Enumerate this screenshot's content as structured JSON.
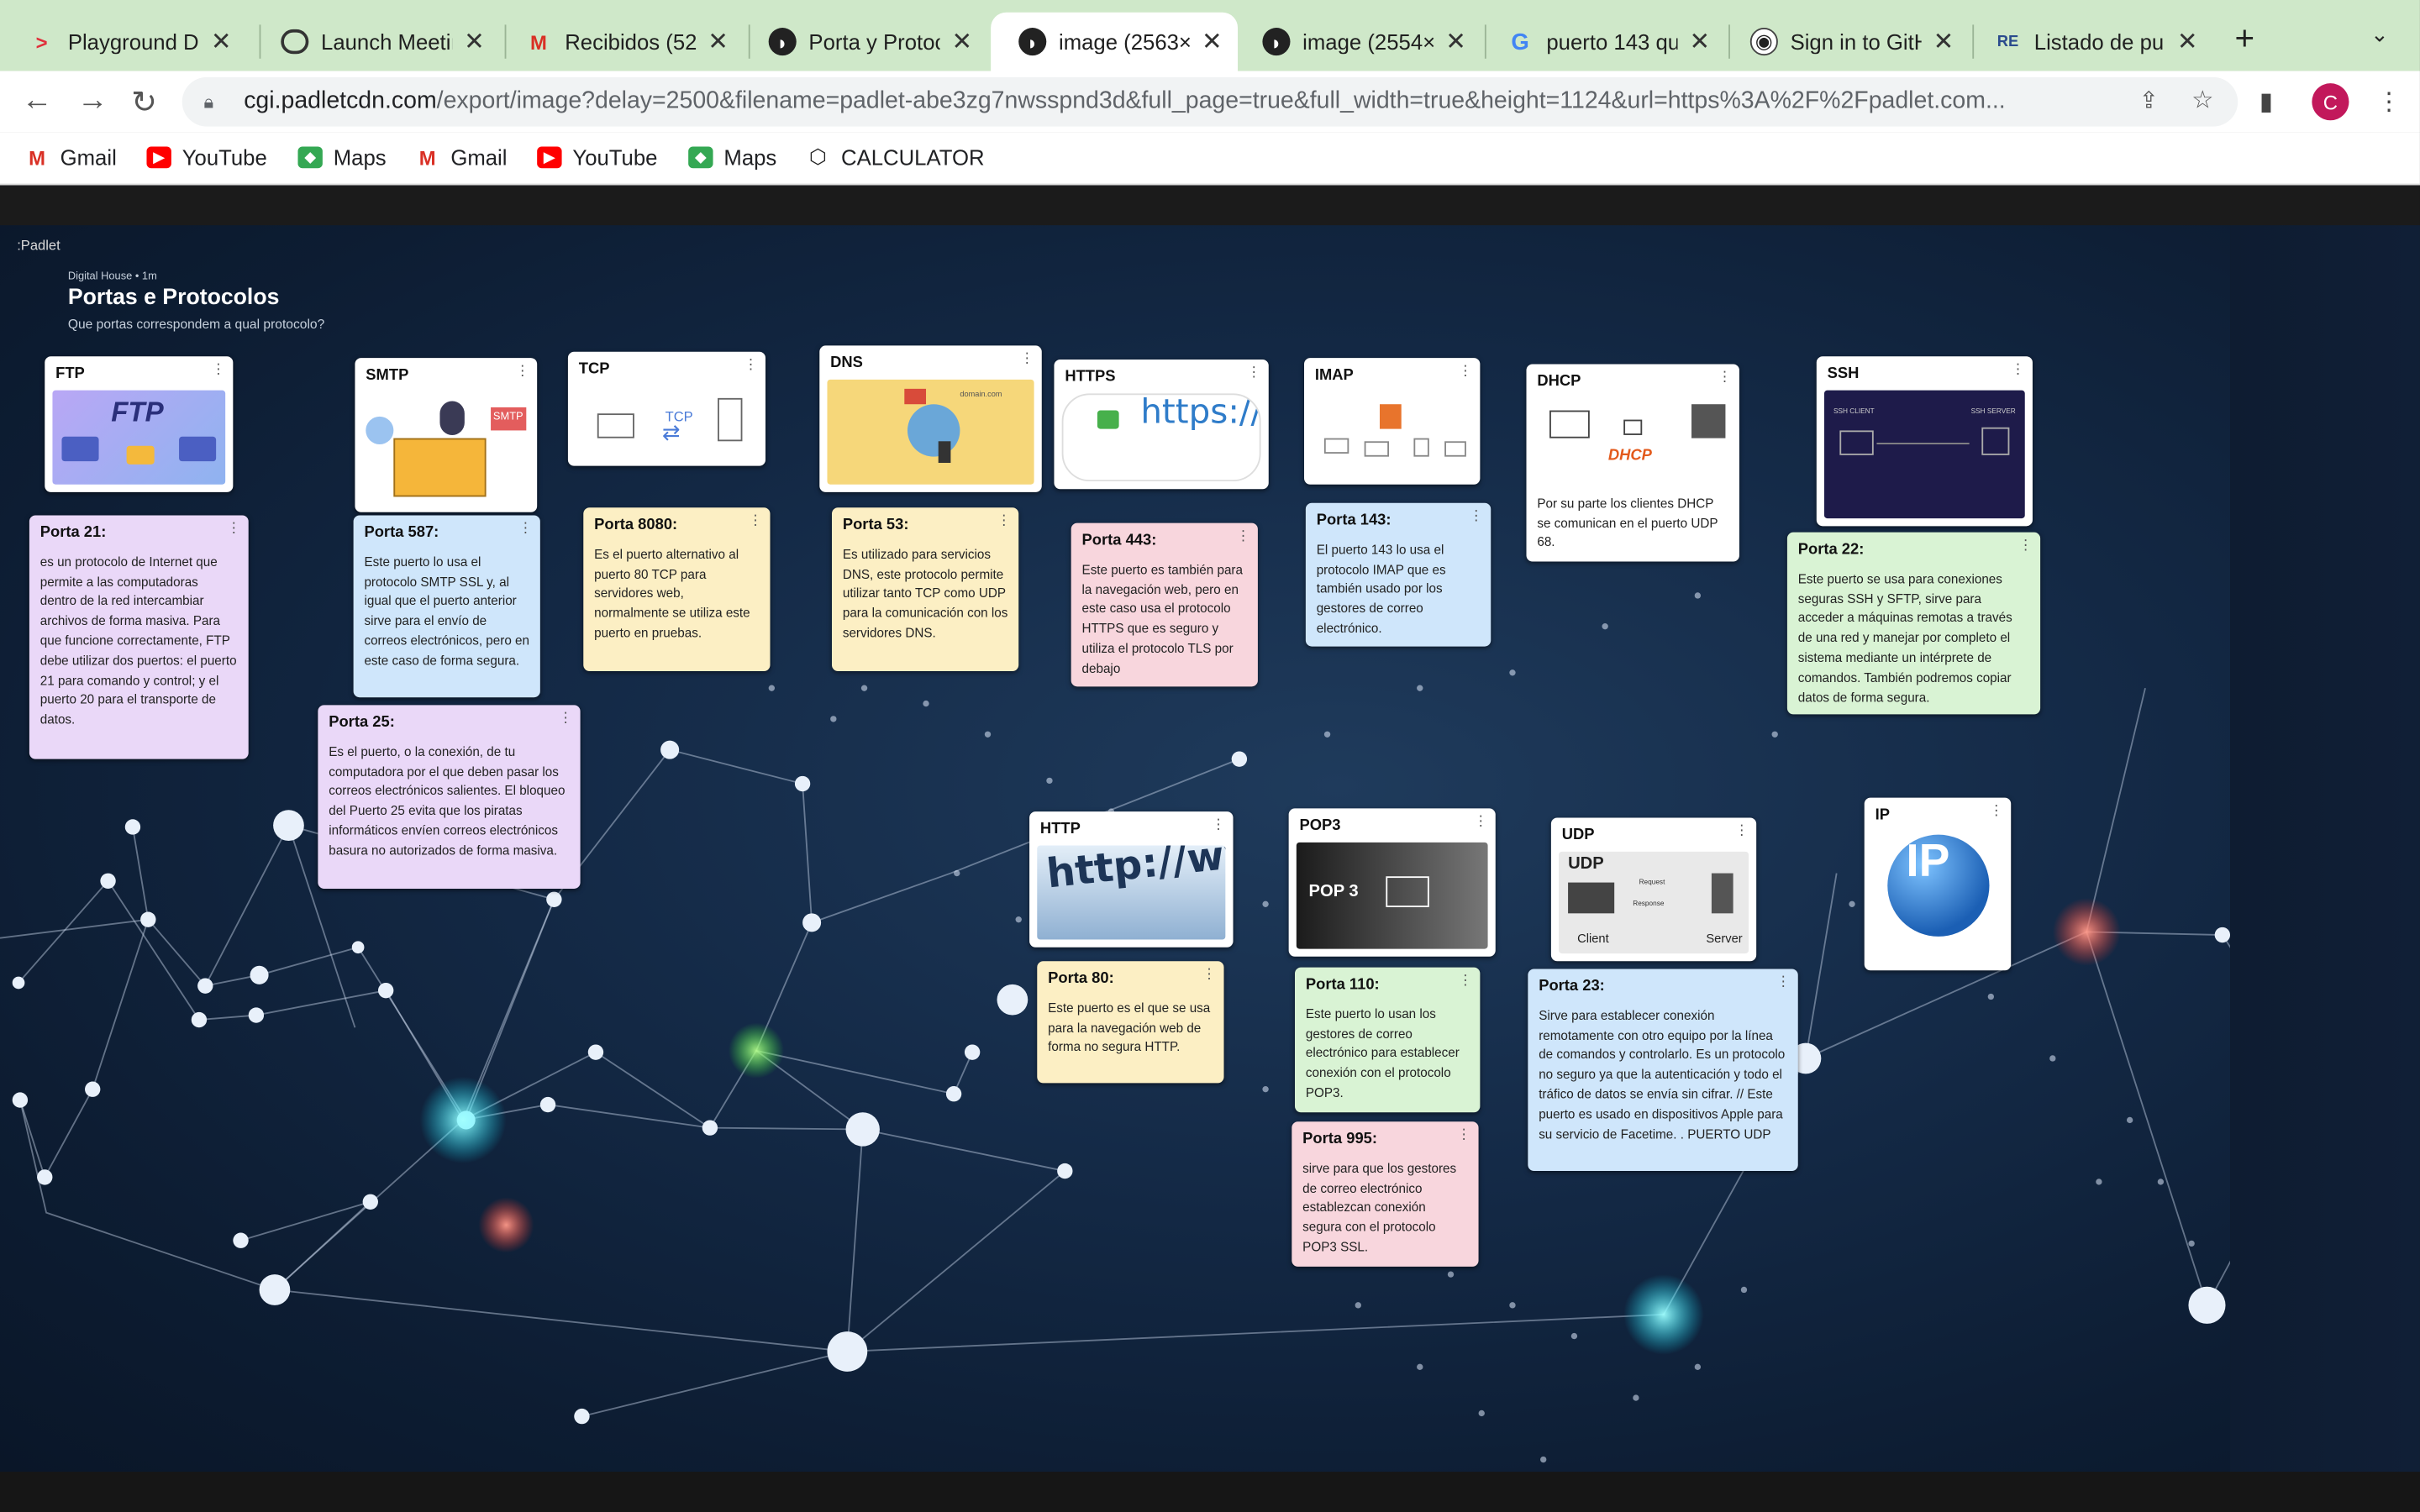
{
  "browser": {
    "tabs": [
      {
        "title": "Playground Di",
        "favicon": "playground-icon"
      },
      {
        "title": "Launch Meetin",
        "favicon": "globe-icon"
      },
      {
        "title": "Recibidos (52",
        "favicon": "gmail-icon"
      },
      {
        "title": "Porta y Protoc",
        "favicon": "padlet-icon"
      },
      {
        "title": "image (2563×",
        "favicon": "padlet-icon",
        "active": true
      },
      {
        "title": "image (2554×",
        "favicon": "padlet-icon"
      },
      {
        "title": "puerto 143 qu",
        "favicon": "google-icon"
      },
      {
        "title": "Sign in to GitH",
        "favicon": "github-icon"
      },
      {
        "title": "Listado de pu",
        "favicon": "site-icon"
      }
    ],
    "url_host": "cgi.padletcdn.com",
    "url_path": "/export/image?delay=2500&filename=padlet-abe3zg7nwsspnd3d&full_page=true&full_width=true&height=1124&url=https%3A%2F%2Fpadlet.com...",
    "avatar_letter": "C",
    "bookmarks": [
      "Gmail",
      "YouTube",
      "Maps",
      "Gmail",
      "YouTube",
      "Maps",
      "CALCULATOR"
    ]
  },
  "padlet": {
    "brand": ":Padlet",
    "org": "Digital House • 1m",
    "title": "Portas e Protocolos",
    "subtitle": "Que portas correspondem a qual protocolo?"
  },
  "cards": {
    "ftp": {
      "title": "FTP",
      "image_text": "FTP"
    },
    "smtp": {
      "title": "SMTP",
      "image_text": "SMTP"
    },
    "tcp": {
      "title": "TCP",
      "image_text": "TCP"
    },
    "dns": {
      "title": "DNS",
      "image_text": "domain.com"
    },
    "https": {
      "title": "HTTPS",
      "image_text": "https://"
    },
    "imap": {
      "title": "IMAP"
    },
    "dhcp": {
      "title": "DHCP",
      "image_text": "DHCP",
      "body": "Por su parte los clientes DHCP se comunican en el puerto UDP 68."
    },
    "ssh": {
      "title": "SSH",
      "image_text_left": "SSH CLIENT",
      "image_text_right": "SSH SERVER"
    },
    "http": {
      "title": "HTTP",
      "image_text": "http://ww"
    },
    "pop3": {
      "title": "POP3",
      "image_text": "POP 3"
    },
    "udp": {
      "title": "UDP",
      "image_text": "UDP",
      "image_client": "Client",
      "image_server": "Server",
      "image_request": "Request",
      "image_response": "Response"
    },
    "ip": {
      "title": "IP",
      "image_text": "IP"
    },
    "porta21": {
      "title": "Porta 21:",
      "body": "es un protocolo de Internet que permite a las computadoras dentro de la red intercambiar archivos de forma masiva. Para que funcione correctamente, FTP debe utilizar dos puertos: el puerto 21 para comando y control; y el puerto 20 para el transporte de datos."
    },
    "porta587": {
      "title": "Porta 587:",
      "body": "Este puerto lo usa el protocolo SMTP SSL y, al igual que el puerto anterior sirve para el envío de correos electrónicos, pero en este caso de forma segura."
    },
    "porta25": {
      "title": "Porta 25:",
      "body": "Es el puerto, o la conexión, de tu computadora por el que deben pasar los correos electrónicos salientes. El bloqueo del Puerto 25 evita que los piratas informáticos envíen correos electrónicos basura no autorizados de forma masiva."
    },
    "porta8080": {
      "title": "Porta 8080:",
      "body": "Es el puerto alternativo al puerto 80 TCP para servidores web, normalmente se utiliza este puerto en pruebas."
    },
    "porta53": {
      "title": "Porta 53:",
      "body": "Es utilizado para servicios DNS, este protocolo permite utilizar tanto TCP como UDP para la comunicación con los servidores DNS."
    },
    "porta443": {
      "title": "Porta 443:",
      "body": "Este puerto es también para la navegación web, pero en este caso usa el protocolo HTTPS que es seguro y utiliza el protocolo TLS por debajo"
    },
    "porta143": {
      "title": "Porta 143:",
      "body": "El puerto 143 lo usa el protocolo IMAP que es también usado por los gestores de correo electrónico."
    },
    "porta22": {
      "title": "Porta 22:",
      "body": "Este puerto se usa para conexiones seguras SSH y SFTP, sirve para acceder a máquinas remotas a través de una red y manejar por completo el sistema mediante un intérprete de comandos. También podremos copiar datos de forma segura."
    },
    "porta80": {
      "title": "Porta 80:",
      "body": "Este puerto es el que se usa para la navegación web de forma no segura HTTP."
    },
    "porta110": {
      "title": "Porta 110:",
      "body": "Este puerto lo usan los gestores de correo electrónico para establecer conexión con el protocolo POP3."
    },
    "porta995": {
      "title": "Porta 995:",
      "body": "sirve para que los gestores de correo electrónico establezcan conexión segura con el protocolo POP3 SSL."
    },
    "porta23": {
      "title": "Porta 23:",
      "body": "Sirve para establecer conexión remotamente con otro equipo por la línea de comandos y controlarlo. Es un protocolo no seguro ya que la autenticación y todo el tráfico de datos se envía sin cifrar. // Este puerto es usado en dispositivos Apple para su servicio de Facetime. . PUERTO UDP"
    }
  },
  "colors": {
    "tab_strip": "#cfe8c9",
    "board_bg": "#142a47"
  }
}
